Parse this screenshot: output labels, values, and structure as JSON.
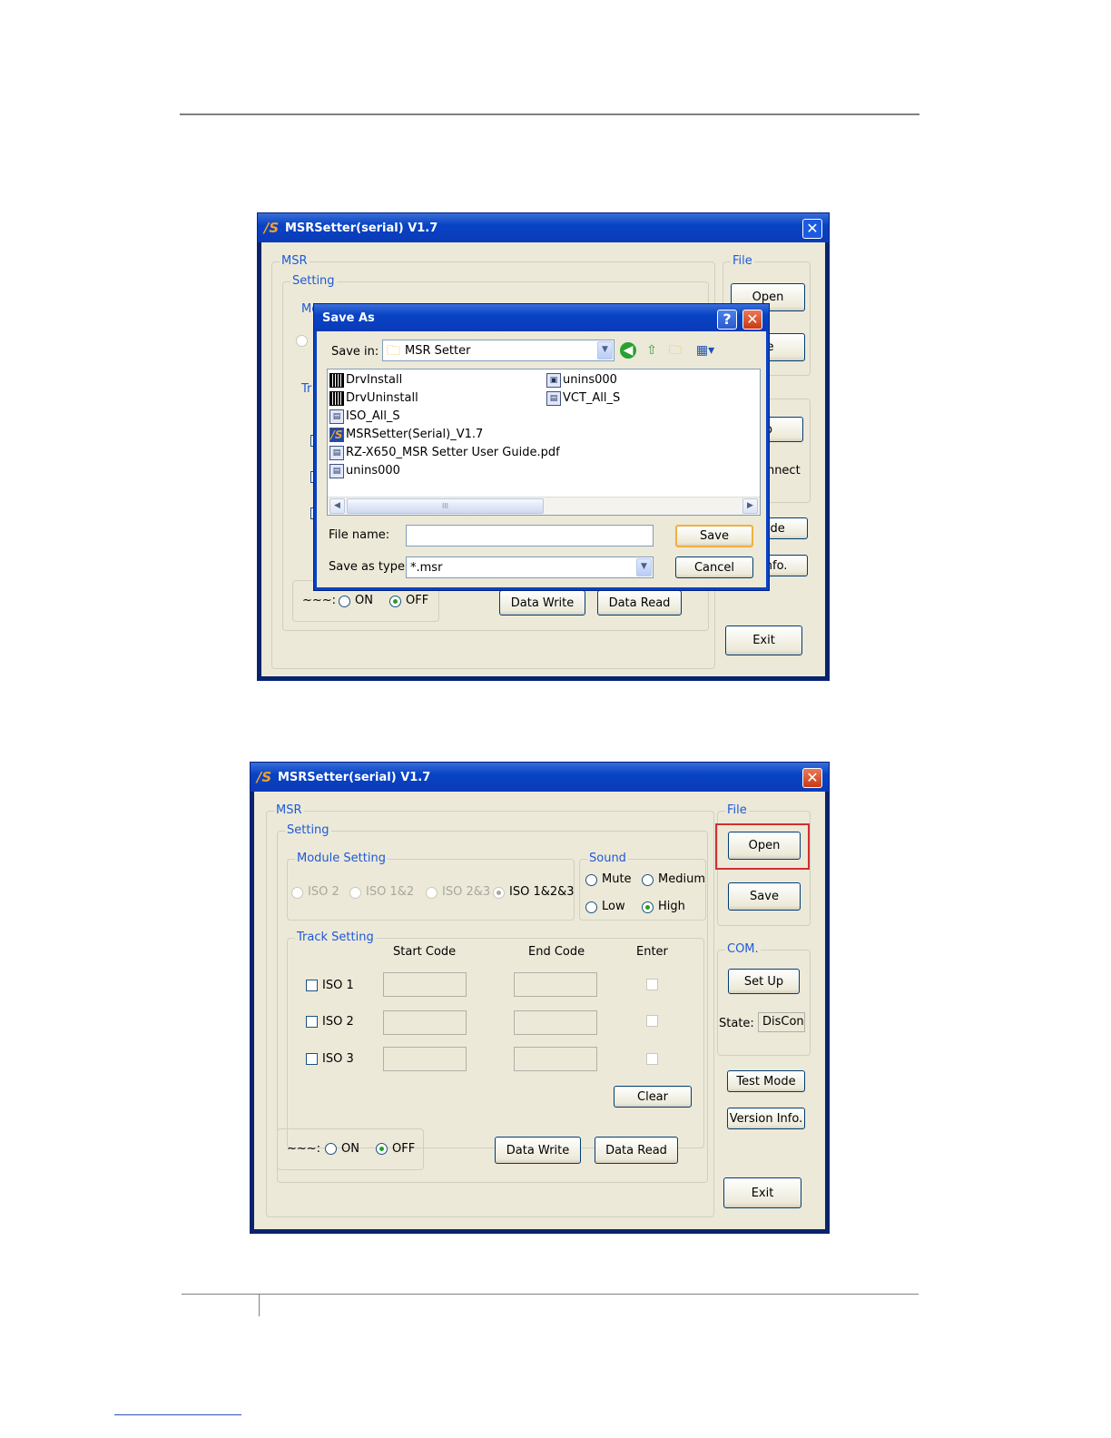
{
  "app_icon": "msr-app-icon",
  "window1": {
    "title": "MSRSetter(serial) V1.7",
    "close_glyph": "✕",
    "msr_label": "MSR",
    "setting_label": "Setting",
    "module_partial": "Mo",
    "track_partial": "Tr",
    "file_label": "File",
    "open": "Open",
    "save_partial": "re",
    "setup_partial": "Jp",
    "state_partial": "onnect",
    "testmode_partial": "Mode",
    "version_partial": "n Info.",
    "tilde": "~~~:",
    "on": "ON",
    "off": "OFF",
    "data_write": "Data Write",
    "data_read": "Data Read",
    "exit": "Exit"
  },
  "save_dialog": {
    "title": "Save As",
    "help_glyph": "?",
    "close_glyph": "✕",
    "save_in_label": "Save in:",
    "save_in_value": "MSR Setter",
    "files_left": [
      "DrvInstall",
      "DrvUninstall",
      "ISO_All_S",
      "MSRSetter(Serial)_V1.7",
      "RZ-X650_MSR Setter User Guide.pdf",
      "unins000"
    ],
    "files_right": [
      "unins000",
      "VCT_All_S"
    ],
    "scroll_mark": "III",
    "file_name_label": "File name:",
    "file_name_value": "",
    "save_type_label": "Save as type:",
    "save_type_value": "*.msr",
    "save_button": "Save",
    "cancel_button": "Cancel"
  },
  "window2": {
    "title": "MSRSetter(serial) V1.7",
    "close_glyph": "✕",
    "msr_label": "MSR",
    "setting_label": "Setting",
    "module_label": "Module Setting",
    "modules": [
      "ISO 2",
      "ISO 1&2",
      "ISO 2&3",
      "ISO 1&2&3"
    ],
    "sound_label": "Sound",
    "sounds": [
      "Mute",
      "Medium",
      "Low",
      "High"
    ],
    "track_label": "Track Setting",
    "col_start": "Start Code",
    "col_end": "End Code",
    "col_enter": "Enter",
    "tracks": [
      "ISO 1",
      "ISO 2",
      "ISO 3"
    ],
    "clear": "Clear",
    "tilde": "~~~:",
    "on": "ON",
    "off": "OFF",
    "data_write": "Data Write",
    "data_read": "Data Read",
    "file_label": "File",
    "open": "Open",
    "save": "Save",
    "com_label": "COM.",
    "setup": "Set Up",
    "state_label": "State:",
    "state_value": "DisCon",
    "test_mode": "Test Mode",
    "version_info": "Version Info.",
    "exit": "Exit"
  }
}
